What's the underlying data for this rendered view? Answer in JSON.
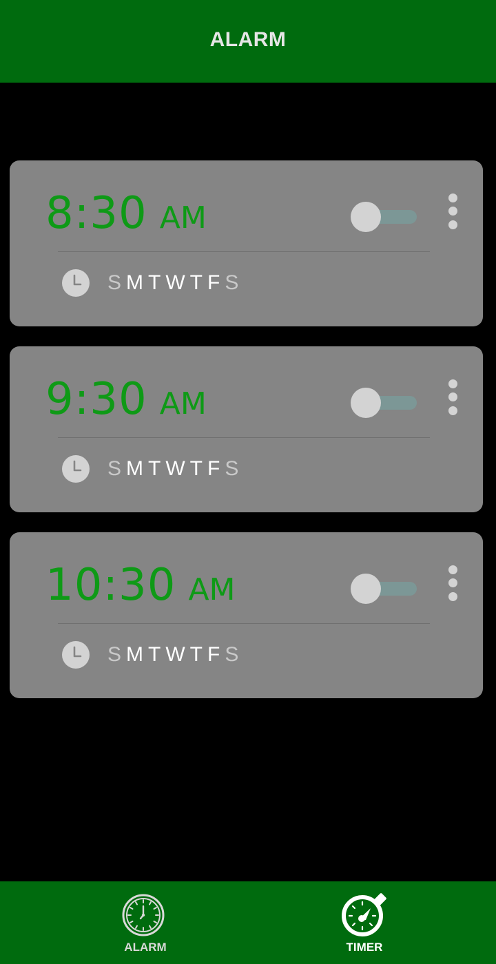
{
  "app_bar": {
    "title": "ALARM"
  },
  "colors": {
    "app_bar_bg": "#006b0e",
    "background": "#000000",
    "card_bg": "#858585",
    "time_text": "#0e9a16",
    "toggle_knob": "#d3d3d3",
    "toggle_track": "#7c9796",
    "day_active": "#ffffff",
    "day_inactive": "#c9c9c9"
  },
  "alarms": [
    {
      "time": "8:30",
      "ampm": "AM",
      "enabled": false,
      "days": [
        {
          "letter": "S",
          "active": false
        },
        {
          "letter": "M",
          "active": true
        },
        {
          "letter": "T",
          "active": true
        },
        {
          "letter": "W",
          "active": true
        },
        {
          "letter": "T",
          "active": true
        },
        {
          "letter": "F",
          "active": true
        },
        {
          "letter": "S",
          "active": false
        }
      ]
    },
    {
      "time": "9:30",
      "ampm": "AM",
      "enabled": false,
      "days": [
        {
          "letter": "S",
          "active": false
        },
        {
          "letter": "M",
          "active": true
        },
        {
          "letter": "T",
          "active": true
        },
        {
          "letter": "W",
          "active": true
        },
        {
          "letter": "T",
          "active": true
        },
        {
          "letter": "F",
          "active": true
        },
        {
          "letter": "S",
          "active": false
        }
      ]
    },
    {
      "time": "10:30",
      "ampm": "AM",
      "enabled": false,
      "days": [
        {
          "letter": "S",
          "active": false
        },
        {
          "letter": "M",
          "active": true
        },
        {
          "letter": "T",
          "active": true
        },
        {
          "letter": "W",
          "active": true
        },
        {
          "letter": "T",
          "active": true
        },
        {
          "letter": "F",
          "active": true
        },
        {
          "letter": "S",
          "active": false
        }
      ]
    }
  ],
  "bottom_nav": {
    "items": [
      {
        "label": "ALARM",
        "icon": "clock-icon",
        "selected": false
      },
      {
        "label": "TIMER",
        "icon": "stopwatch-icon",
        "selected": true
      }
    ]
  }
}
